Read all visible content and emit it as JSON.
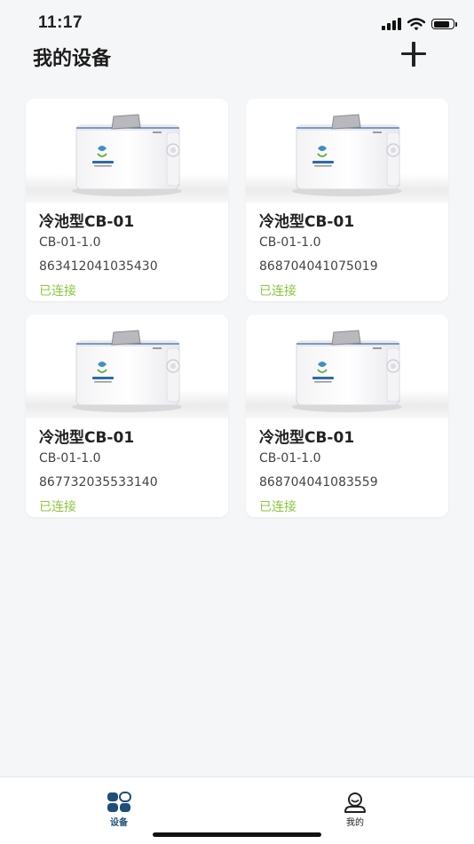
{
  "status_bar": {
    "time": "11:17"
  },
  "header": {
    "title": "我的设备"
  },
  "devices": [
    {
      "name": "冷池型CB-01",
      "model": "CB-01-1.0",
      "serial": "863412041035430",
      "status": "已连接"
    },
    {
      "name": "冷池型CB-01",
      "model": "CB-01-1.0",
      "serial": "868704041075019",
      "status": "已连接"
    },
    {
      "name": "冷池型CB-01",
      "model": "CB-01-1.0",
      "serial": "867732035533140",
      "status": "已连接"
    },
    {
      "name": "冷池型CB-01",
      "model": "CB-01-1.0",
      "serial": "868704041083559",
      "status": "已连接"
    }
  ],
  "tabs": [
    {
      "label": "设备",
      "icon": "devices-grid-icon",
      "active": true
    },
    {
      "label": "我的",
      "icon": "user-profile-icon",
      "active": false
    }
  ],
  "colors": {
    "connected": "#8cc63f",
    "active_tab": "#1f4e79",
    "background": "#f5f6f8"
  }
}
